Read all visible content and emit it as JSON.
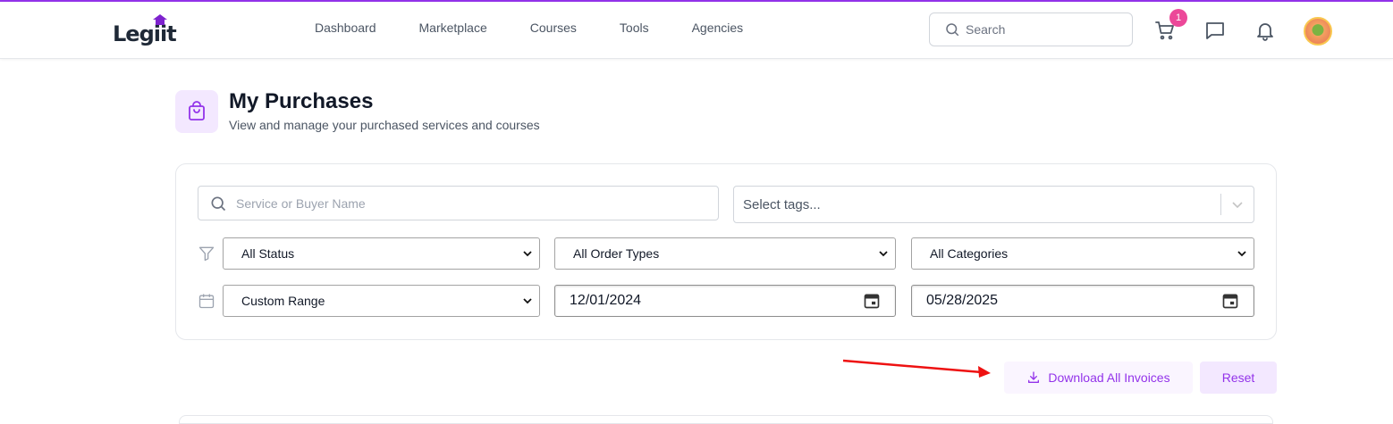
{
  "header": {
    "logo_text": "Legiit",
    "nav": [
      "Dashboard",
      "Marketplace",
      "Courses",
      "Tools",
      "Agencies"
    ],
    "search_placeholder": "Search",
    "cart_count": "1"
  },
  "page": {
    "title": "My Purchases",
    "subtitle": "View and manage your purchased services and courses"
  },
  "filters": {
    "search_placeholder": "Service or Buyer Name",
    "tags_placeholder": "Select tags...",
    "status": "All Status",
    "order_types": "All Order Types",
    "categories": "All Categories",
    "range": "Custom Range",
    "date_from": "12/01/2024",
    "date_to": "05/28/2025"
  },
  "actions": {
    "download_label": "Download All Invoices",
    "reset_label": "Reset"
  },
  "colors": {
    "accent": "#9333ea",
    "badge": "#ec4899",
    "annotation_arrow": "#ee1111"
  }
}
